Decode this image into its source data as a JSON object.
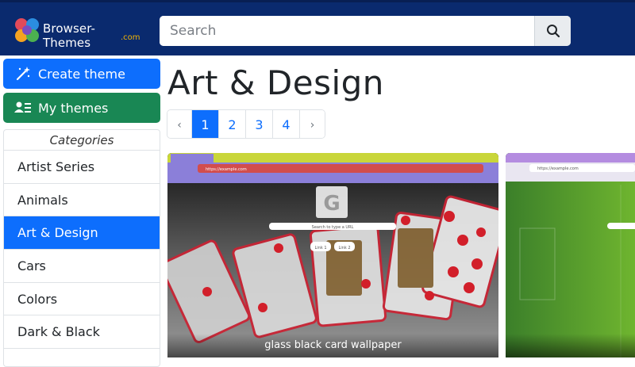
{
  "header": {
    "logo_text": "Browser-Themes",
    "logo_sub": ".com",
    "search_placeholder": "Search"
  },
  "sidebar": {
    "create_label": "Create theme",
    "mine_label": "My themes",
    "categories_title": "Categories",
    "categories": [
      "Artist Series",
      "Animals",
      "Art & Design",
      "Cars",
      "Colors",
      "Dark & Black"
    ],
    "active_category": "Art & Design"
  },
  "main": {
    "title": "Art & Design",
    "pagination": [
      "‹",
      "1",
      "2",
      "3",
      "4",
      "›"
    ],
    "current_page": "1",
    "cards": [
      {
        "caption": "glass black card wallpaper",
        "preview_center_letter": "G",
        "preview_search_text": "Search to type a URL",
        "preview_url": "https://example.com",
        "preview_links": [
          "Link 1",
          "Link 2"
        ]
      },
      {
        "caption": "",
        "preview_url": "https://example.com"
      }
    ]
  },
  "colors": {
    "header_bg": "#0a2a6e",
    "primary": "#0d6efd",
    "success": "#198754"
  }
}
